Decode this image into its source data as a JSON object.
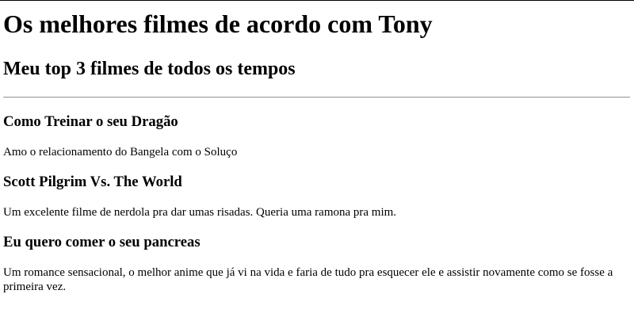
{
  "page": {
    "title": "Os melhores filmes de acordo com Tony",
    "subtitle": "Meu top 3 filmes de todos os tempos"
  },
  "movies": [
    {
      "title": "Como Treinar o seu Dragão",
      "description": "Amo o relacionamento do Bangela com o Soluço"
    },
    {
      "title": "Scott Pilgrim Vs. The World",
      "description": "Um excelente filme de nerdola pra dar umas risadas. Queria uma ramona pra mim."
    },
    {
      "title": "Eu quero comer o seu pancreas",
      "description": "Um romance sensacional, o melhor anime que já vi na vida e faria de tudo pra esquecer ele e assistir novamente como se fosse a primeira vez."
    }
  ]
}
